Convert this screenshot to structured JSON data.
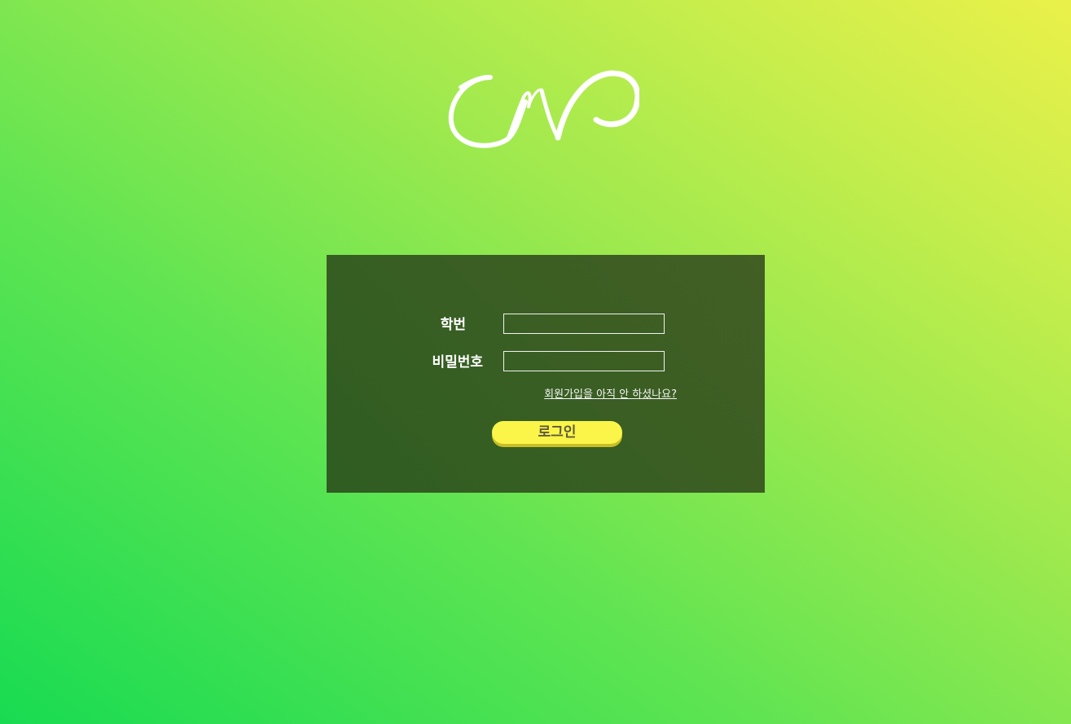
{
  "logo": {
    "icon": "calligraphic-cm-logo"
  },
  "login": {
    "student_id_label": "학번",
    "student_id_value": "",
    "password_label": "비밀번호",
    "password_value": "",
    "signup_link": "회원가입을 아직 안 하셨나요?",
    "login_button": "로그인"
  },
  "colors": {
    "panel": "#3a5e23",
    "button": "#fbf54a",
    "button_shadow": "#c8bf26",
    "button_text": "#5f5a3a",
    "gradient_start": "#18db52",
    "gradient_end": "#ebf04a"
  }
}
